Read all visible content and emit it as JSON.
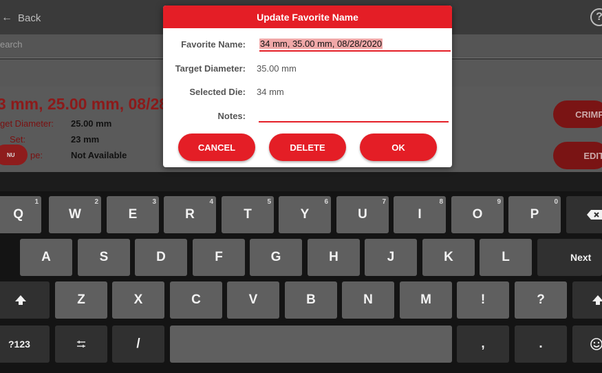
{
  "app": {
    "back_label": "Back",
    "help_label": "?",
    "search_placeholder": "earch",
    "favorite_title": "3 mm, 25.00 mm, 08/28",
    "details": [
      {
        "label": "get Diameter:",
        "value": "25.00 mm"
      },
      {
        "label": "Set:",
        "value": "23 mm"
      },
      {
        "label": "pe:",
        "value": "Not Available"
      }
    ],
    "menu_badge": "NU",
    "crimp_label": "CRIMP",
    "edit_label": "EDIT"
  },
  "dialog": {
    "title": "Update Favorite Name",
    "favorite_name_label": "Favorite Name:",
    "favorite_name_value": "34 mm, 35.00 mm, 08/28/2020",
    "target_diameter_label": "Target Diameter:",
    "target_diameter_value": "35.00 mm",
    "selected_die_label": "Selected Die:",
    "selected_die_value": "34 mm",
    "notes_label": "Notes:",
    "notes_value": "",
    "cancel_label": "CANCEL",
    "delete_label": "DELETE",
    "ok_label": "OK"
  },
  "keyboard": {
    "row1": [
      {
        "label": "Q",
        "hint": "1"
      },
      {
        "label": "W",
        "hint": "2"
      },
      {
        "label": "E",
        "hint": "3"
      },
      {
        "label": "R",
        "hint": "4"
      },
      {
        "label": "T",
        "hint": "5"
      },
      {
        "label": "Y",
        "hint": "6"
      },
      {
        "label": "U",
        "hint": "7"
      },
      {
        "label": "I",
        "hint": "8"
      },
      {
        "label": "O",
        "hint": "9"
      },
      {
        "label": "P",
        "hint": "0"
      }
    ],
    "row2": [
      "A",
      "S",
      "D",
      "F",
      "G",
      "H",
      "J",
      "K",
      "L"
    ],
    "row3": [
      "Z",
      "X",
      "C",
      "V",
      "B",
      "N",
      "M",
      "!",
      "?"
    ],
    "next_label": "Next",
    "symbols_label": "?123",
    "slash_label": "/",
    "comma_label": ",",
    "period_label": ".",
    "icons": {
      "backspace": "backspace-icon",
      "shift": "shift-icon",
      "settings": "settings-icon",
      "emoji": "emoji-icon",
      "back": "back-arrow-icon"
    }
  },
  "colors": {
    "accent": "#e41e26",
    "keyboard_bg": "#141414",
    "key_bg": "#5f5f5f"
  }
}
